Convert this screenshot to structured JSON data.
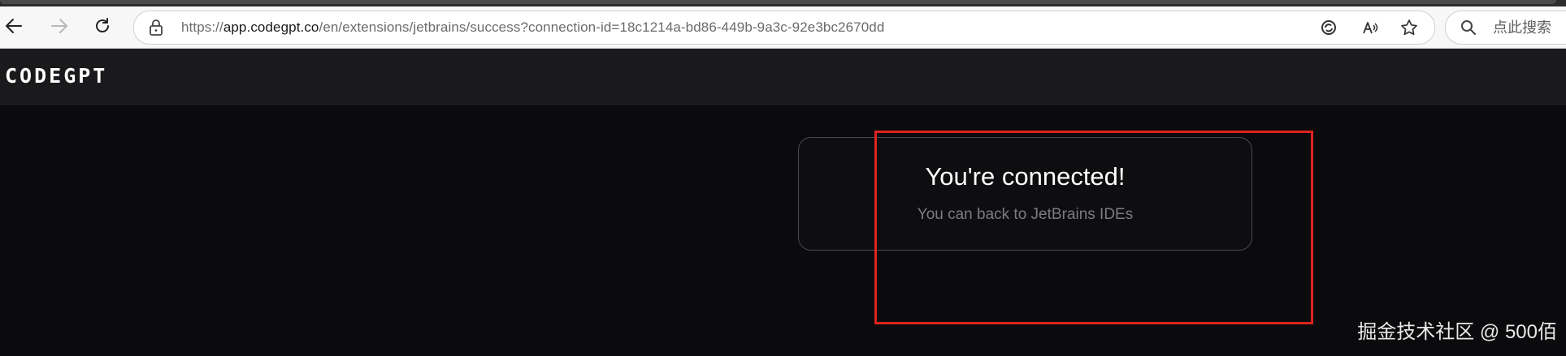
{
  "browser": {
    "url_prefix": "https://",
    "url_host": "app.codegpt.co",
    "url_path": "/en/extensions/jetbrains/success?connection-id=18c1214a-bd86-449b-9a3c-92e3bc2670dd",
    "search_placeholder": "点此搜索",
    "icons": [
      "back-arrow-icon",
      "forward-arrow-icon",
      "reload-icon",
      "lock-icon",
      "edge-refresh-icon",
      "read-aloud-icon",
      "favorite-star-icon",
      "search-icon"
    ]
  },
  "app": {
    "logo": "CODEGPT"
  },
  "card": {
    "title": "You're connected!",
    "subtitle": "You can back to JetBrains IDEs"
  },
  "overlay": {
    "highlight_color": "#e0231f",
    "watermark": "掘金技术社区 @ 500佰"
  },
  "colors": {
    "page_bg": "#0b0b0d",
    "header_bg": "#1a1a1c",
    "card_border": "#4a4a4e",
    "subtitle": "#7b7b80"
  }
}
